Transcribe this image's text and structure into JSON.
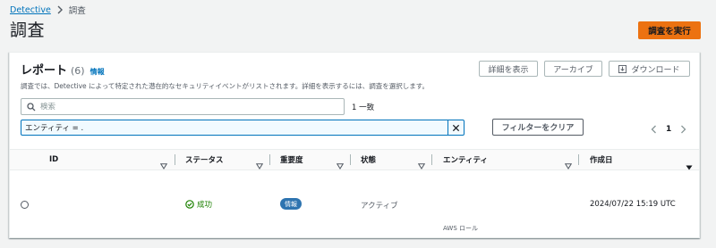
{
  "breadcrumb": {
    "root": "Detective",
    "current": "調査"
  },
  "page": {
    "title": "調査",
    "run_button": "調査を実行"
  },
  "panel": {
    "title": "レポート",
    "count": "(6)",
    "info": "情報",
    "description": "調査では、Detective によって特定された潜在的なセキュリティイベントがリストされます。詳細を表示するには、調査を選択します。",
    "buttons": {
      "details": "詳細を表示",
      "archive": "アーカイブ",
      "download": "ダウンロード"
    }
  },
  "search": {
    "placeholder": "検索",
    "value": "",
    "match_count": "1 一致"
  },
  "filter": {
    "token": "エンティティ = .",
    "clear_button": "フィルターをクリア"
  },
  "pagination": {
    "current_page": "1"
  },
  "table": {
    "columns": [
      "ID",
      "ステータス",
      "重要度",
      "状態",
      "エンティティ",
      "作成日"
    ],
    "rows": [
      {
        "id": "",
        "status": "成功",
        "severity": "情報",
        "state": "アクティブ",
        "entity": "AWS ロール",
        "created": "2024/07/22 15:19 UTC"
      }
    ]
  },
  "colors": {
    "accent": "#ec7211",
    "link": "#0073bb",
    "success": "#1d8102",
    "info_badge": "#2e74b0"
  }
}
